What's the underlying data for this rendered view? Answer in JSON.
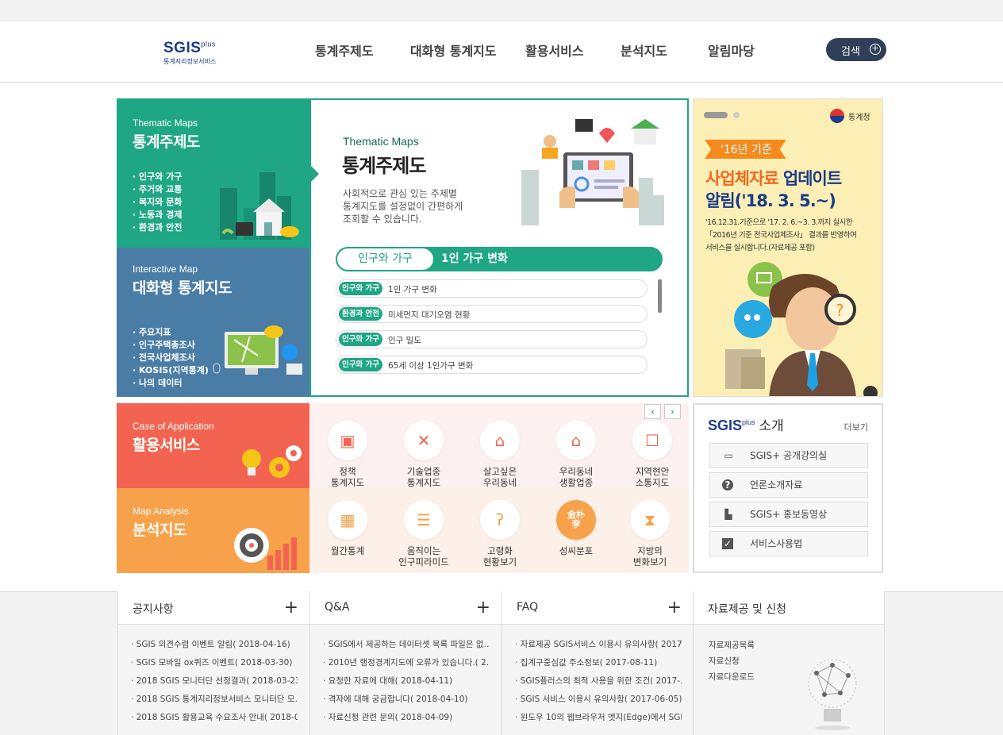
{
  "header": {
    "logo_main": "SGIS",
    "logo_sup": "plus",
    "logo_sub": "통계지리정보서비스",
    "nav": [
      "통계주제도",
      "대화형 통계지도",
      "활용서비스",
      "분석지도",
      "알림마당"
    ],
    "search_label": "검색"
  },
  "thematic_tile": {
    "en": "Thematic Maps",
    "ko": "통계주제도",
    "items": [
      "인구와 가구",
      "주거와 교통",
      "복지와 문화",
      "노동과 경제",
      "환경과 안전"
    ]
  },
  "interactive_tile": {
    "en": "Interactive Map",
    "ko": "대화형 통계지도",
    "items": [
      "주요지표",
      "인구주택총조사",
      "전국사업체조사",
      "KOSIS(지역통계)",
      "나의 데이터"
    ]
  },
  "center": {
    "title_en": "Thematic Maps",
    "title_ko": "통계주제도",
    "desc": [
      "사회적으로 관심 있는 주제별",
      "통계지도를 설정없이 간편하게",
      "조회할 수 있습니다."
    ],
    "tab_active": "인구와 가구",
    "tab_title": "1인 가구 변화",
    "rows": [
      {
        "badge": "인구와 가구",
        "text": "1인 가구 변화"
      },
      {
        "badge": "환경과 안전",
        "text": "미세먼지 대기오염 현황"
      },
      {
        "badge": "인구와 가구",
        "text": "인구 밀도"
      },
      {
        "badge": "인구와 가구",
        "text": "65세 이상 1인가구 변화"
      }
    ]
  },
  "banner": {
    "org": "통계청",
    "tag": "'16년 기준",
    "title1a": "사업체자료",
    "title1b": " 업데이트",
    "title2": "알림('18. 3. 5.~)",
    "desc": [
      "'16.12.31.기준으로 '17. 2. 6.~3. 3.까지 실시한",
      "「2016년 기준 전국사업체조사」 결과를 반영하여",
      "서비스를 실시합니다.(자료제공 포함)"
    ]
  },
  "app_tile": {
    "en": "Case of Application",
    "ko": "활용서비스"
  },
  "analysis_tile": {
    "en": "Map Analysis",
    "ko": "분석지도"
  },
  "services_row1": [
    {
      "l1": "정책",
      "l2": "통계지도",
      "icon": "chart-monitor-icon"
    },
    {
      "l1": "기술업종",
      "l2": "통계지도",
      "icon": "tools-icon"
    },
    {
      "l1": "살고싶은",
      "l2": "우리동네",
      "icon": "shop-icon"
    },
    {
      "l1": "우리동네",
      "l2": "생활업종",
      "icon": "house-icon"
    },
    {
      "l1": "지역현안",
      "l2": "소통지도",
      "icon": "board-icon"
    }
  ],
  "services_row2": [
    {
      "l1": "월간통계",
      "l2": "",
      "icon": "calendar-icon"
    },
    {
      "l1": "움직이는",
      "l2": "인구피라미드",
      "icon": "pyramid-icon"
    },
    {
      "l1": "고령화",
      "l2": "현황보기",
      "icon": "cane-icon"
    },
    {
      "l1": "성씨분포",
      "l2": "",
      "icon": "surname-icon",
      "glyph": "金朴\n李"
    },
    {
      "l1": "지방의",
      "l2": "변화보기",
      "icon": "hourglass-icon"
    }
  ],
  "intro": {
    "title_logo": "SGIS",
    "title_sup": "plus",
    "title_ko": "소개",
    "more": "더보기",
    "buttons": [
      "SGIS+ 공개강의실",
      "언론소개자료",
      "SGIS+ 홍보동영상",
      "서비스사용법"
    ]
  },
  "footer": {
    "notice": {
      "title": "공지사항",
      "items": [
        "SGIS 의견수렴 이벤트 알림( 2018-04-16)",
        "SGIS 모바일 ox퀴즈 이벤트( 2018-03-30)",
        "2018 SGIS 모니터단 선정결과( 2018-03-23)",
        "2018 SGIS 통계지리정보서비스 모니터단 모…",
        "2018 SGIS 활용교육 수요조사 안내( 2018-0…"
      ]
    },
    "qna": {
      "title": "Q&A",
      "items": [
        "SGIS에서 제공하는 데이터셋 목록 파일은 없…",
        "2010년 행정경계지도에 오류가 있습니다.( 2…",
        "요청한 자료에 대해( 2018-04-11)",
        "격자에 대해 궁금합니다( 2018-04-10)",
        "자료신청 관련 문의( 2018-04-09)"
      ]
    },
    "faq": {
      "title": "FAQ",
      "items": [
        "자료제공 SGIS서비스 이용시 유의사항( 2017…",
        "집계구중심값 주소정보( 2017-08-11)",
        "SGIS플러스의 최적 사용을 위한 조건( 2017-…",
        "SGIS 서비스 이용시 유의사항( 2017-06-05)",
        "윈도우 10의 웹브라우저 엣지(Edge)에서 SGI…"
      ]
    },
    "data": {
      "title": "자료제공 및 신청",
      "items": [
        "자료제공목록",
        "자료신청",
        "자료다운로드"
      ]
    }
  },
  "colors": {
    "teal": "#1fa685",
    "blue": "#4a7da6",
    "red": "#f26451",
    "orange": "#f7a14a",
    "navy": "#2e3f57"
  }
}
